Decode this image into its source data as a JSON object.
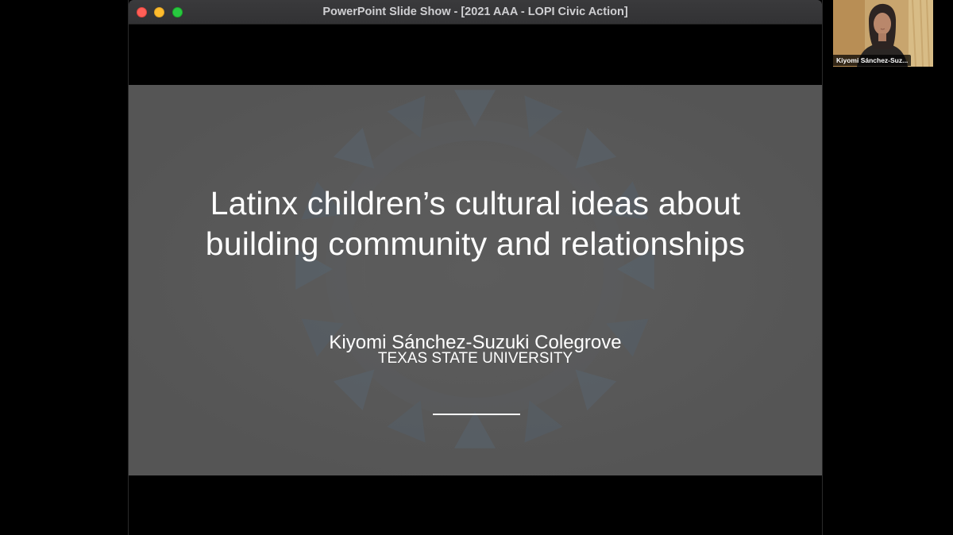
{
  "window": {
    "title": "PowerPoint Slide Show - [2021 AAA - LOPI Civic Action]"
  },
  "slide": {
    "title_line1": "Latinx children’s cultural ideas about",
    "title_line2": "building community and relationships",
    "author": "Kiyomi Sánchez-Suzuki Colegrove",
    "affiliation": "TEXAS STATE UNIVERSITY"
  },
  "participant": {
    "name": "Kiyomi Sánchez-Suz..."
  },
  "colors": {
    "slide_background": "#585858",
    "close": "#ff5f57",
    "minimize": "#febc2e",
    "zoom": "#28c840"
  }
}
